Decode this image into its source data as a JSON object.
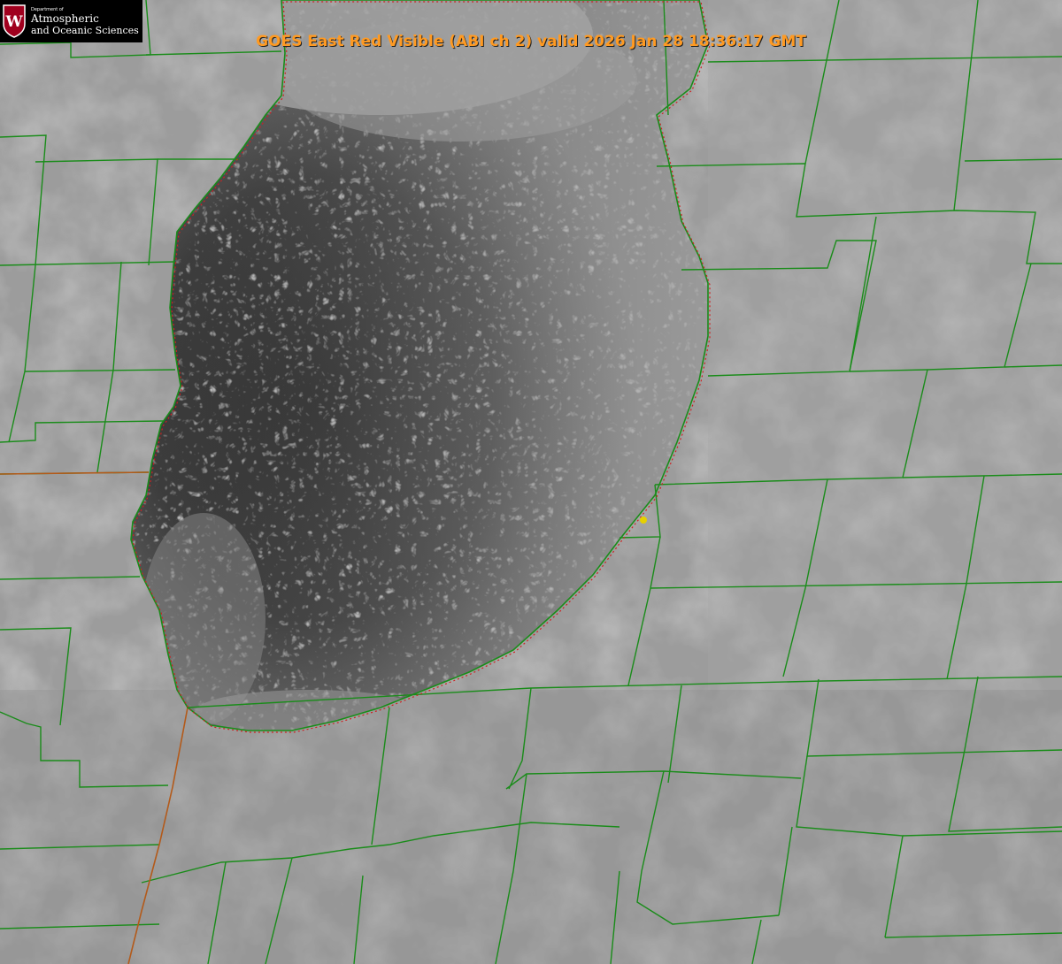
{
  "header": {
    "title": "GOES East Red Visible (ABI ch 2) valid 2026 Jan 28 18:36:17 GMT"
  },
  "logo": {
    "dept": "Department of",
    "line1": "Atmospheric",
    "line2": "and Oceanic Sciences",
    "shield_letter": "W"
  },
  "colors": {
    "county_lines": "#1a8c1a",
    "state_line": "#b35a1a",
    "shoreline": "#cc2222",
    "marker": "#e6d000",
    "title_text": "#ff9a22",
    "logo_shield": "#a0001e"
  }
}
